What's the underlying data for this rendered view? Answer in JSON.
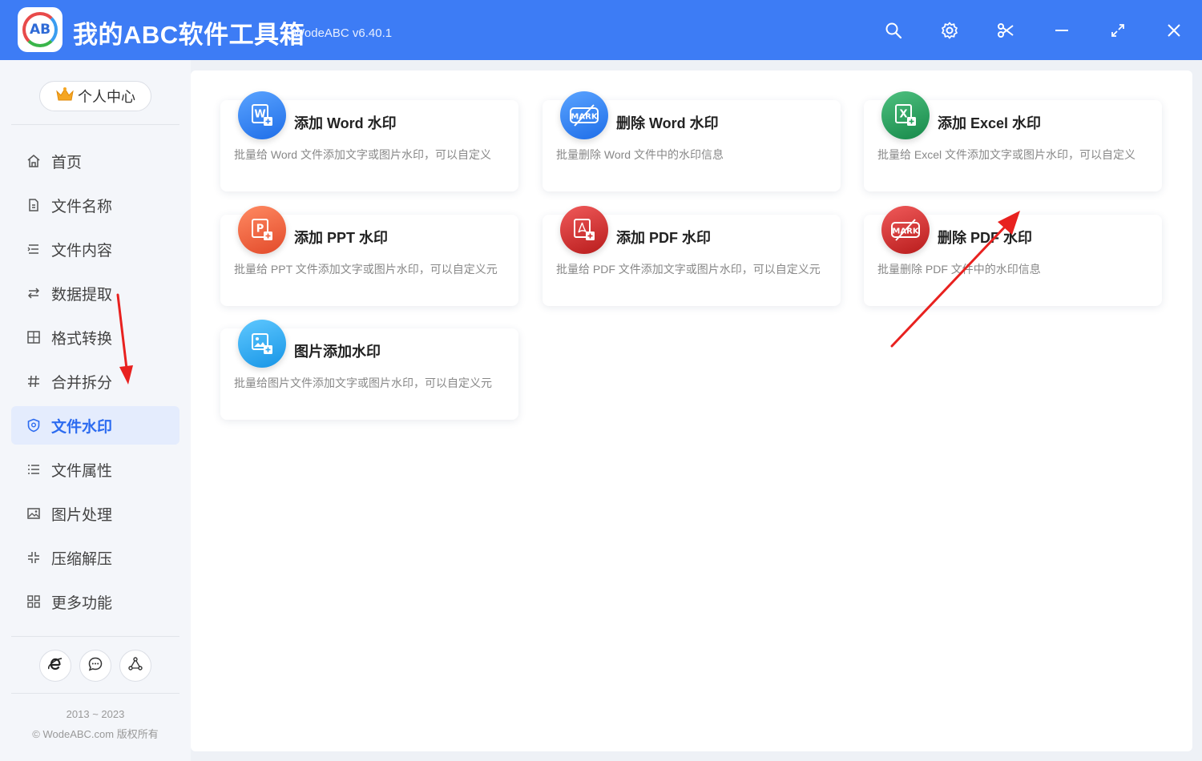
{
  "app": {
    "title": "我的ABC软件工具箱",
    "version": "WodeABC v6.40.1",
    "logo_text": "AB"
  },
  "titlebar_icons": [
    "search-icon",
    "settings-gear-icon",
    "scissors-icon",
    "minimize-icon",
    "maximize-icon",
    "close-icon"
  ],
  "sidebar": {
    "user_center": "个人中心",
    "items": [
      {
        "label": "首页",
        "icon": "home-icon"
      },
      {
        "label": "文件名称",
        "icon": "file-name-icon"
      },
      {
        "label": "文件内容",
        "icon": "file-content-icon"
      },
      {
        "label": "数据提取",
        "icon": "data-extract-icon"
      },
      {
        "label": "格式转换",
        "icon": "format-convert-icon"
      },
      {
        "label": "合并拆分",
        "icon": "merge-split-icon"
      },
      {
        "label": "文件水印",
        "icon": "watermark-icon",
        "active": true
      },
      {
        "label": "文件属性",
        "icon": "file-attributes-icon"
      },
      {
        "label": "图片处理",
        "icon": "image-process-icon"
      },
      {
        "label": "压缩解压",
        "icon": "compress-icon"
      },
      {
        "label": "更多功能",
        "icon": "more-icon"
      }
    ],
    "bottom_buttons": [
      "browser-e-icon",
      "chat-bubble-icon",
      "share-nodes-icon"
    ],
    "copyright_years": "2013 ~ 2023",
    "copyright_text": "© WodeABC.com 版权所有"
  },
  "cards": [
    {
      "title": "添加 Word 水印",
      "desc": "批量给 Word 文件添加文字或图片水印，可以自定义",
      "color": "#2f7ff0",
      "icon": "word-add-icon"
    },
    {
      "title": "删除 Word 水印",
      "desc": "批量删除 Word 文件中的水印信息",
      "color": "#2f7ff0",
      "icon": "word-mark-remove-icon"
    },
    {
      "title": "添加 Excel 水印",
      "desc": "批量给 Excel 文件添加文字或图片水印，可以自定义",
      "color": "#21a05a",
      "icon": "excel-add-icon"
    },
    {
      "title": "添加 PPT 水印",
      "desc": "批量给 PPT 文件添加文字或图片水印，可以自定义元",
      "color": "#f0623e",
      "icon": "ppt-add-icon"
    },
    {
      "title": "添加 PDF 水印",
      "desc": "批量给 PDF 文件添加文字或图片水印，可以自定义元",
      "color": "#d42a2a",
      "icon": "pdf-add-icon"
    },
    {
      "title": "删除 PDF 水印",
      "desc": "批量删除 PDF 文件中的水印信息",
      "color": "#d42a2a",
      "icon": "pdf-mark-remove-icon"
    },
    {
      "title": "图片添加水印",
      "desc": "批量给图片文件添加文字或图片水印，可以自定义元",
      "color": "#28a8f2",
      "icon": "image-add-icon"
    }
  ],
  "colors": {
    "titlebar": "#3d7cf5",
    "accent": "#2c6bf0",
    "arrow": "#e8211f"
  }
}
